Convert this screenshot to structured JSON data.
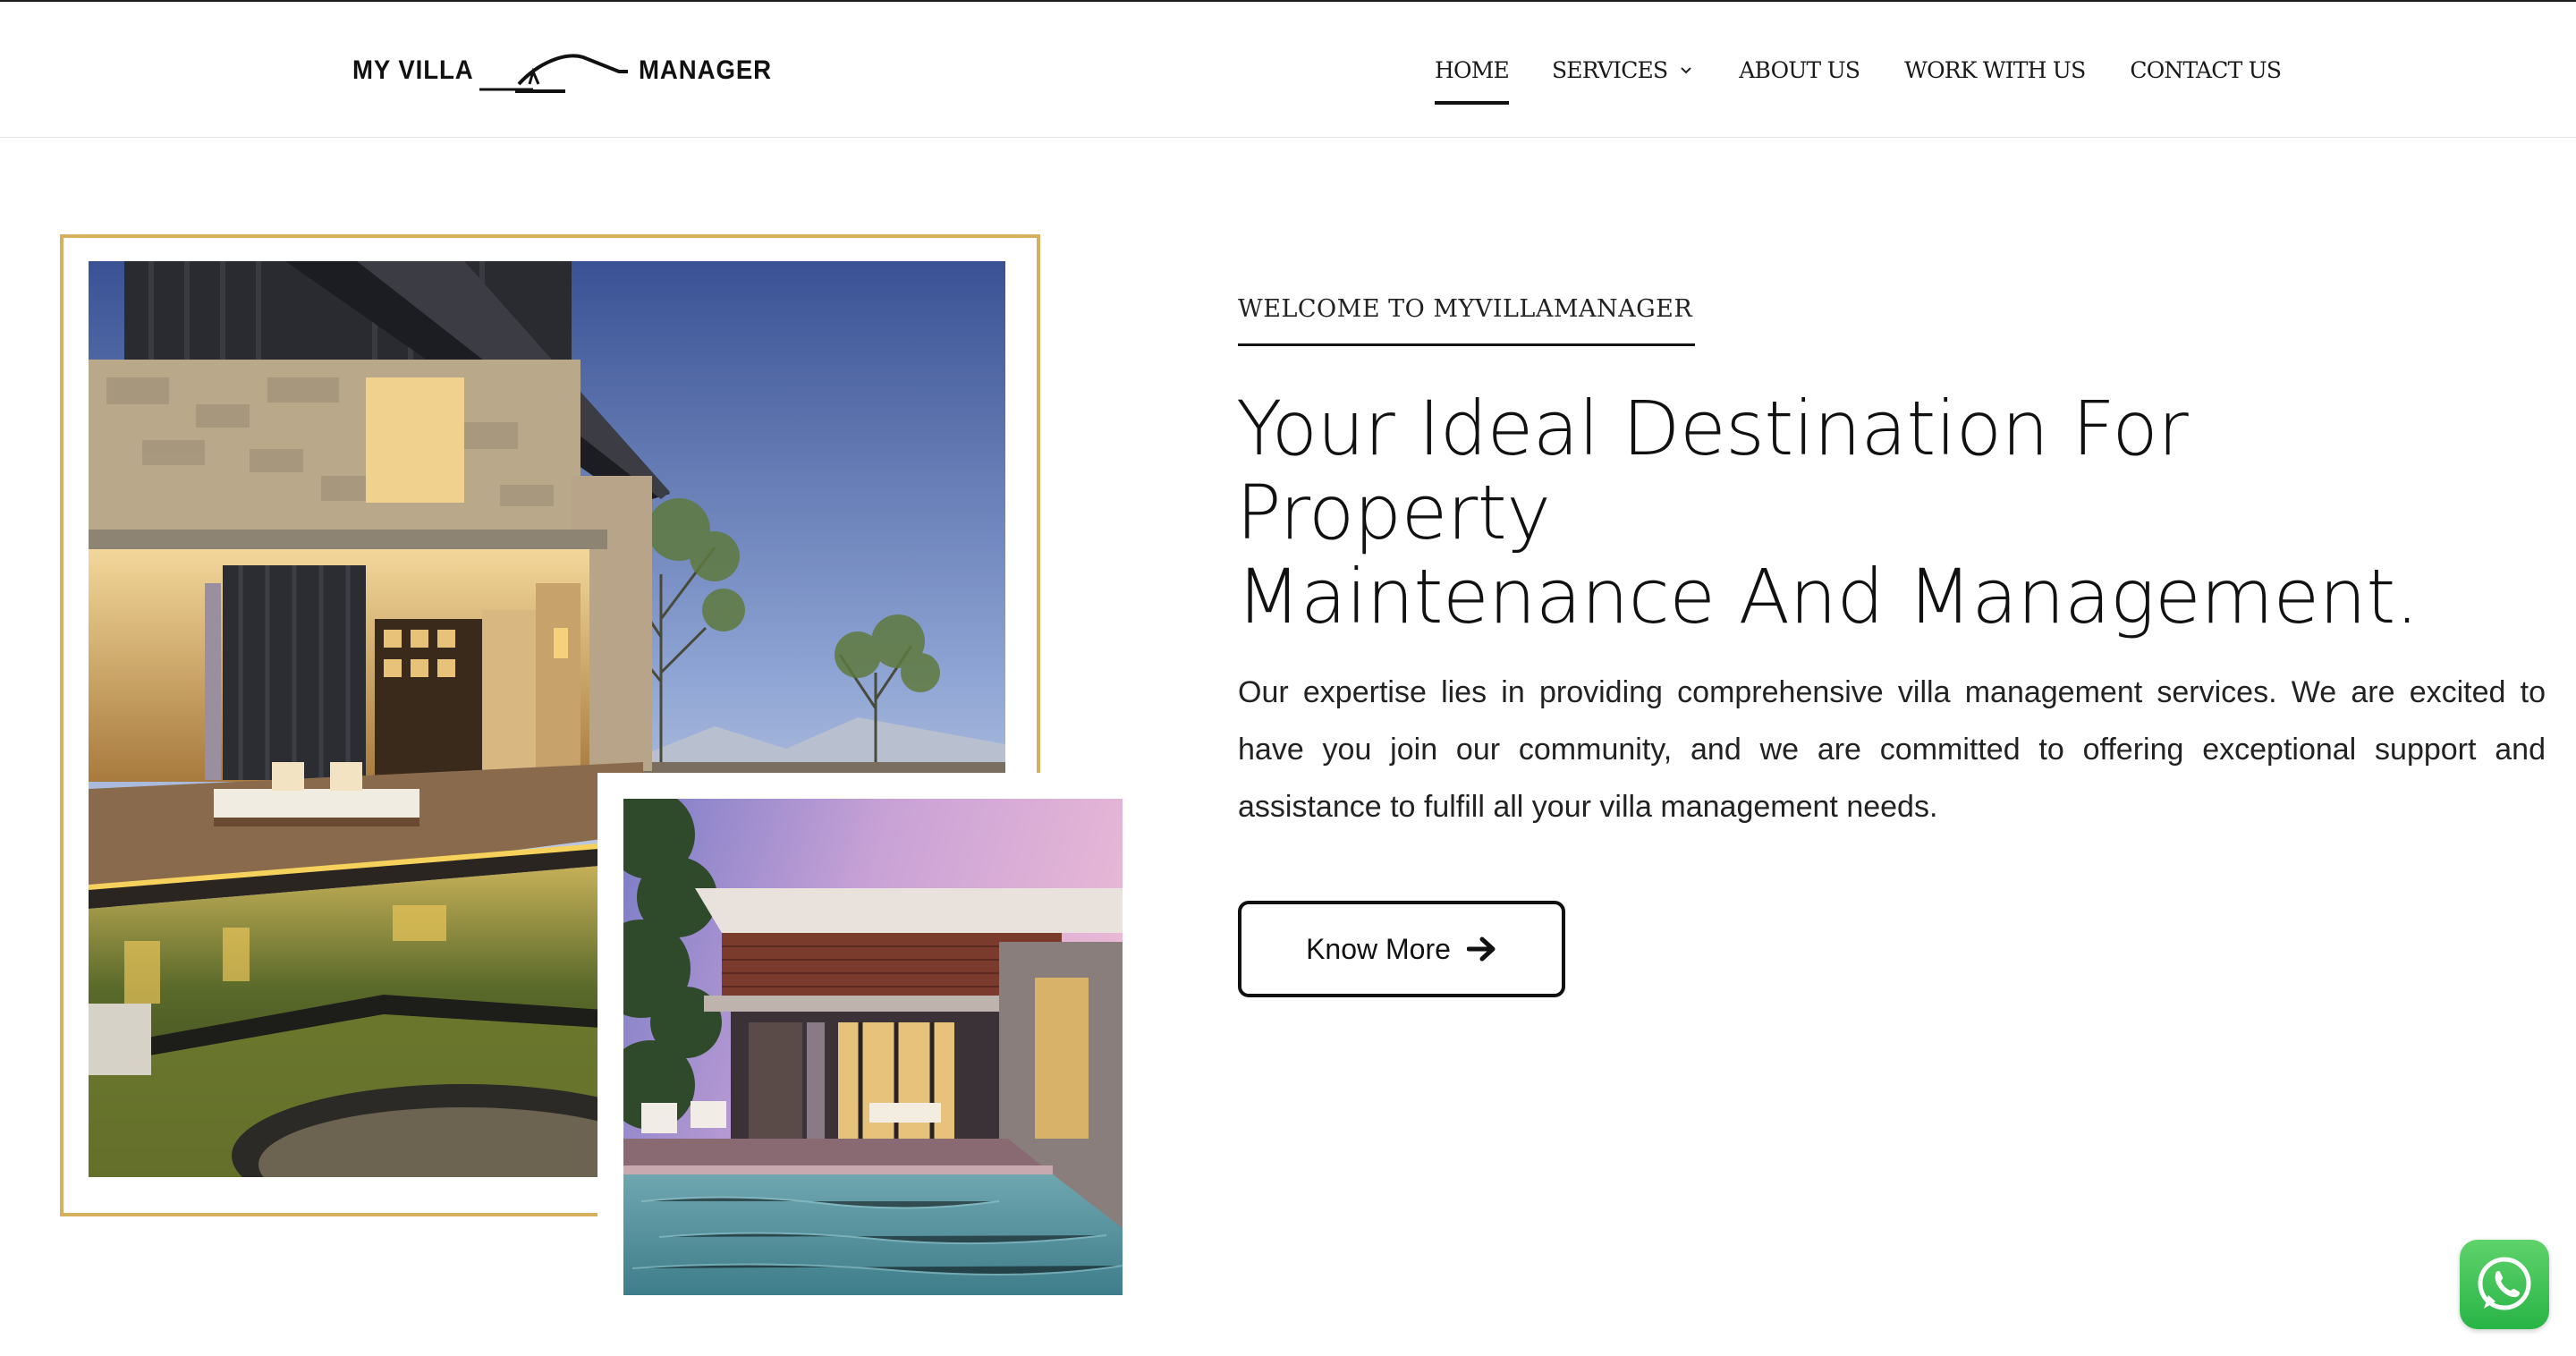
{
  "header": {
    "logo_left": "MY VILLA",
    "logo_right": "MANAGER",
    "nav": [
      {
        "label": "HOME",
        "active": true
      },
      {
        "label": "SERVICES",
        "has_dropdown": true
      },
      {
        "label": "ABOUT US"
      },
      {
        "label": "WORK WITH US"
      },
      {
        "label": "CONTACT US"
      }
    ]
  },
  "hero": {
    "eyebrow": "WELCOME TO MYVILLAMANAGER",
    "headline_line1": "Your Ideal Destination For Property",
    "headline_line2": "Maintenance And Management.",
    "body": "Our expertise lies in providing comprehensive villa management services. We are excited to have you join our community, and we are committed to offering exceptional support and assistance to fulfill all your villa management needs.",
    "cta_label": "Know More",
    "cta_icon": "arrow-right-icon"
  },
  "images": {
    "main_icon": "villa-photo-dusk",
    "secondary_icon": "villa-pool-photo-twilight"
  },
  "floating": {
    "whatsapp_icon": "whatsapp-icon"
  },
  "colors": {
    "accent_gold": "#d7b05e",
    "text_dark": "#111111",
    "whatsapp_green": "#28b446"
  }
}
